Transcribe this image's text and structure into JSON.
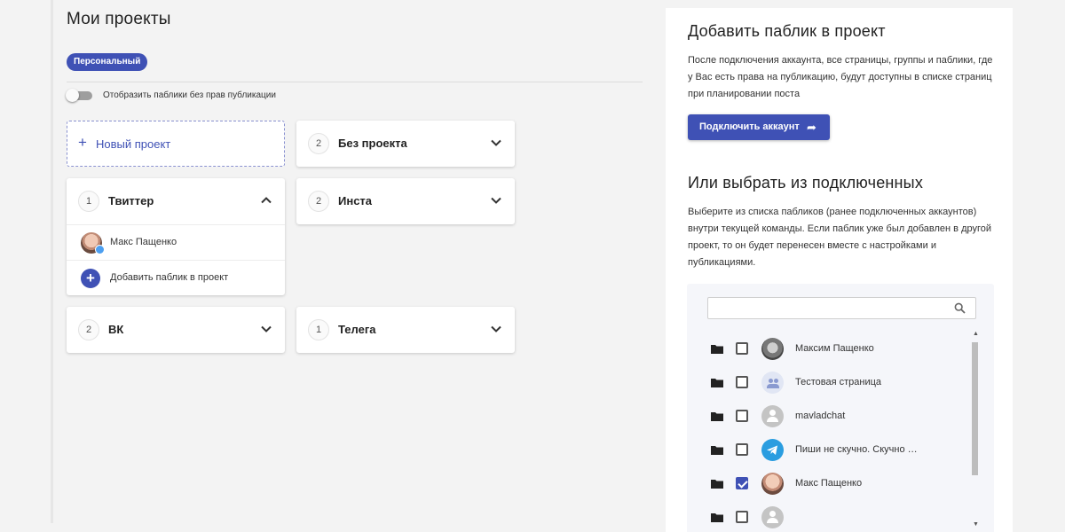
{
  "projects": {
    "title": "Мои проекты",
    "chip": "Персональный",
    "toggle_label": "Отобразить паблики без прав публикации",
    "toggle_on": false,
    "new_project": "Новый проект",
    "cards": [
      {
        "count": "2",
        "name": "Без проекта",
        "expanded": false
      },
      {
        "count": "1",
        "name": "Твиттер",
        "expanded": true,
        "items": [
          {
            "name": "Макс Пащенко",
            "icon": "twitter-icon"
          }
        ],
        "add_label": "Добавить паблик в проект"
      },
      {
        "count": "2",
        "name": "Инста",
        "expanded": false
      },
      {
        "count": "2",
        "name": "ВК",
        "expanded": false
      },
      {
        "count": "1",
        "name": "Телега",
        "expanded": false
      }
    ]
  },
  "panel": {
    "add_title": "Добавить паблик в проект",
    "add_text": "После подключения аккаунта, все страницы, группы и паблики, где у Вас есть права на публикацию, будут доступны в списке страниц при планировании поста",
    "connect_button": "Подключить аккаунт",
    "choose_title": "Или выбрать из подключенных",
    "choose_text": "Выберите из списка пабликов (ранее подключенных аккаунтов) внутри текущей команды. Если паблик уже был добавлен в другой проект, то он будет перенесен вместе с настройками и публикациями.",
    "search_placeholder": "",
    "list": [
      {
        "name": "Максим Пащенко",
        "checked": false,
        "avatar": "photo"
      },
      {
        "name": "Тестовая страница",
        "checked": false,
        "avatar": "group-icon"
      },
      {
        "name": "mavladchat",
        "checked": false,
        "avatar": "person-icon"
      },
      {
        "name": "Пиши не скучно. Скучно …",
        "checked": false,
        "avatar": "telegram-icon"
      },
      {
        "name": "Макс Пащенко",
        "checked": true,
        "avatar": "photo"
      },
      {
        "name": "",
        "checked": false,
        "avatar": "person-icon"
      }
    ]
  },
  "colors": {
    "accent": "#3f51b5",
    "background": "#f3f3f3",
    "telegram": "#2a9de0"
  }
}
